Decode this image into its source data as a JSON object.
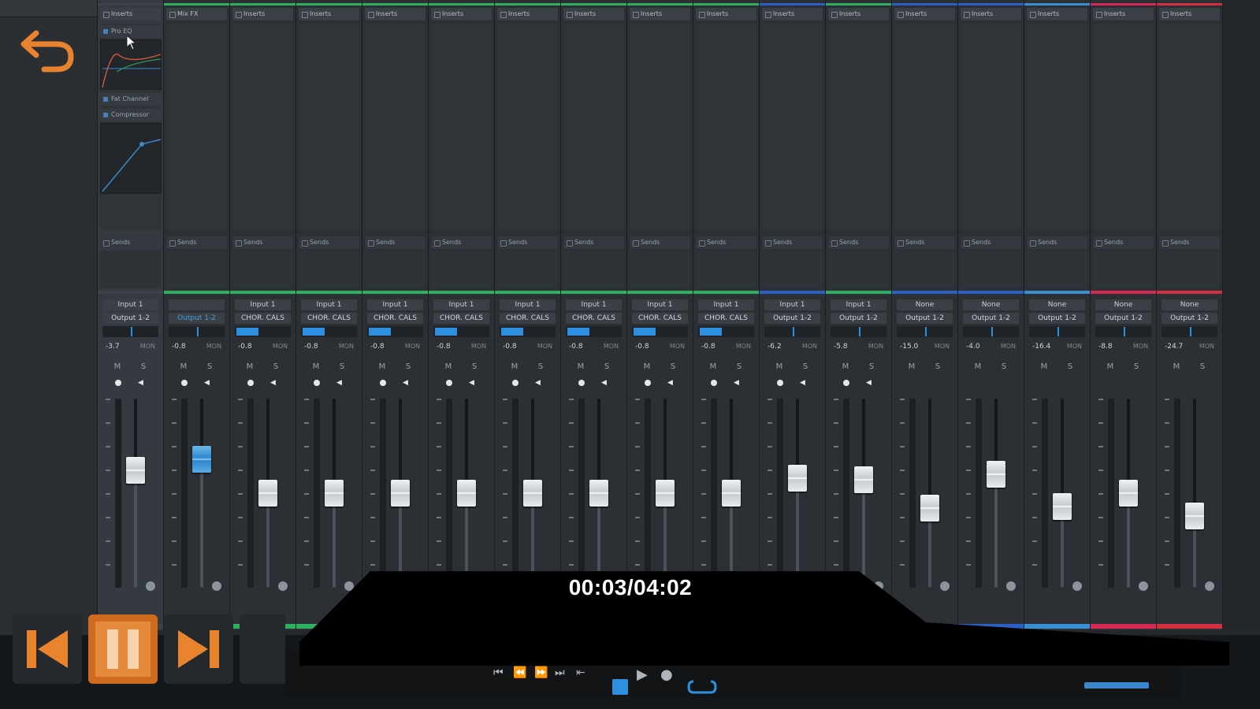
{
  "player": {
    "timecode": "00:03/04:02",
    "accent": "#e9832d"
  },
  "left_panel": {
    "inserts_label": "Inserts",
    "plugins": [
      "Pro EQ",
      "Fat Channel",
      "Compressor"
    ]
  },
  "channels": [
    {
      "header": "Inserts",
      "input": "Input 1",
      "output": "Output 1-2",
      "gain": "-3.7",
      "auto": "MON",
      "color": "#3e4349",
      "selected": true,
      "fader": 0.62,
      "cap": "white"
    },
    {
      "header": "Mix FX",
      "input": "",
      "output": "Output 1-2",
      "gain": "-0.8",
      "auto": "MON",
      "color": "#2fb061",
      "fader": 0.68,
      "cap": "blue",
      "output_blue": true
    },
    {
      "header": "Inserts",
      "input": "Input 1",
      "output": "CHOR. CALS",
      "gain": "-0.8",
      "auto": "MON",
      "color": "#2fb061",
      "fader": 0.5,
      "cap": "white"
    },
    {
      "header": "Inserts",
      "input": "Input 1",
      "output": "CHOR. CALS",
      "gain": "-0.8",
      "auto": "MON",
      "color": "#2fb061",
      "fader": 0.5,
      "cap": "white"
    },
    {
      "header": "Inserts",
      "input": "Input 1",
      "output": "CHOR. CALS",
      "gain": "-0.8",
      "auto": "MON",
      "color": "#2fb061",
      "fader": 0.5,
      "cap": "white"
    },
    {
      "header": "Inserts",
      "input": "Input 1",
      "output": "CHOR. CALS",
      "gain": "-0.8",
      "auto": "MON",
      "color": "#2fb061",
      "fader": 0.5,
      "cap": "white"
    },
    {
      "header": "Inserts",
      "input": "Input 1",
      "output": "CHOR. CALS",
      "gain": "-0.8",
      "auto": "MON",
      "color": "#2fb061",
      "fader": 0.5,
      "cap": "white"
    },
    {
      "header": "Inserts",
      "input": "Input 1",
      "output": "CHOR. CALS",
      "gain": "-0.8",
      "auto": "MON",
      "color": "#2fb061",
      "fader": 0.5,
      "cap": "white"
    },
    {
      "header": "Inserts",
      "input": "Input 1",
      "output": "CHOR. CALS",
      "gain": "-0.8",
      "auto": "MON",
      "color": "#2fb061",
      "fader": 0.5,
      "cap": "white"
    },
    {
      "header": "Inserts",
      "input": "Input 1",
      "output": "CHOR. CALS",
      "gain": "-0.8",
      "auto": "MON",
      "color": "#2fb061",
      "fader": 0.5,
      "cap": "white"
    },
    {
      "header": "Inserts",
      "input": "Input 1",
      "output": "Output 1-2",
      "gain": "-6.2",
      "auto": "MON",
      "color": "#2a5fc4",
      "fader": 0.58,
      "cap": "white"
    },
    {
      "header": "Inserts",
      "input": "Input 1",
      "output": "Output 1-2",
      "gain": "-5.8",
      "auto": "MON",
      "color": "#2fb061",
      "fader": 0.57,
      "cap": "white"
    },
    {
      "header": "Inserts",
      "input": "None",
      "output": "Output 1-2",
      "gain": "-15.0",
      "auto": "MON",
      "color": "#2a5fc4",
      "fader": 0.42,
      "cap": "white"
    },
    {
      "header": "Inserts",
      "input": "None",
      "output": "Output 1-2",
      "gain": "-4.0",
      "auto": "MON",
      "color": "#2a5fc4",
      "fader": 0.6,
      "cap": "white"
    },
    {
      "header": "Inserts",
      "input": "None",
      "output": "Output 1-2",
      "gain": "-16.4",
      "auto": "MON",
      "color": "#3a8fd0",
      "fader": 0.43,
      "cap": "white"
    },
    {
      "header": "Inserts",
      "input": "None",
      "output": "Output 1-2",
      "gain": "-8.8",
      "auto": "MON",
      "color": "#d62a55",
      "fader": 0.5,
      "cap": "white"
    },
    {
      "header": "Inserts",
      "input": "None",
      "output": "Output 1-2",
      "gain": "-24.7",
      "auto": "MON",
      "color": "#d43040",
      "fader": 0.38,
      "cap": "white"
    }
  ],
  "channel_labels": {
    "sends": "Sends",
    "mute": "M",
    "solo": "S"
  }
}
